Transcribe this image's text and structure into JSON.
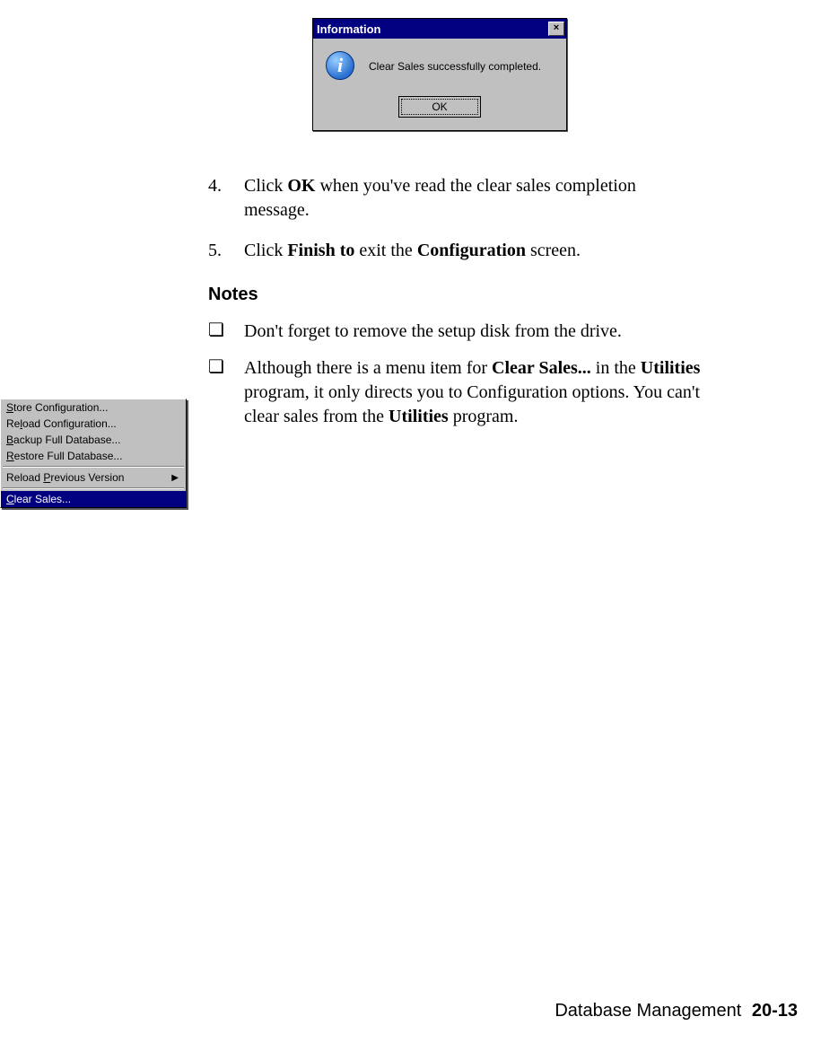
{
  "dialog": {
    "title": "Information",
    "close_glyph": "×",
    "info_glyph": "i",
    "message": "Clear Sales successfully completed.",
    "ok_label": "OK"
  },
  "steps": [
    {
      "num": "4.",
      "pre": "Click ",
      "bold1": "OK",
      "post": " when you've read the clear sales completion message."
    },
    {
      "num": "5.",
      "pre": "Click ",
      "bold1": "Finish to",
      "mid": " exit the ",
      "bold2": "Configuration",
      "post": " screen."
    }
  ],
  "notes_heading": "Notes",
  "notes": [
    {
      "bullet": "❏",
      "text": "Don't forget to remove the setup disk from the drive."
    },
    {
      "bullet": "❏",
      "pre": "Although there is a menu item for ",
      "bold1": "Clear Sales...",
      "mid1": " in the ",
      "bold2": "Utilities",
      "mid2": " program, it only directs you to Configuration options. You can't clear sales from the ",
      "bold3": "Utilities",
      "post": " program."
    }
  ],
  "menu": {
    "items": [
      {
        "ul": "S",
        "rest": "tore Configuration..."
      },
      {
        "pre": "Re",
        "ul": "l",
        "rest": "oad Configuration..."
      },
      {
        "ul": "B",
        "rest": "ackup Full Database..."
      },
      {
        "ul": "R",
        "rest": "estore Full Database..."
      }
    ],
    "submenu": {
      "pre": "Reload ",
      "ul": "P",
      "rest": "revious Version",
      "arrow": "▶"
    },
    "selected": {
      "ul": "C",
      "rest": "lear Sales..."
    }
  },
  "footer": {
    "chapter": "Database Management",
    "page": "20-13"
  }
}
